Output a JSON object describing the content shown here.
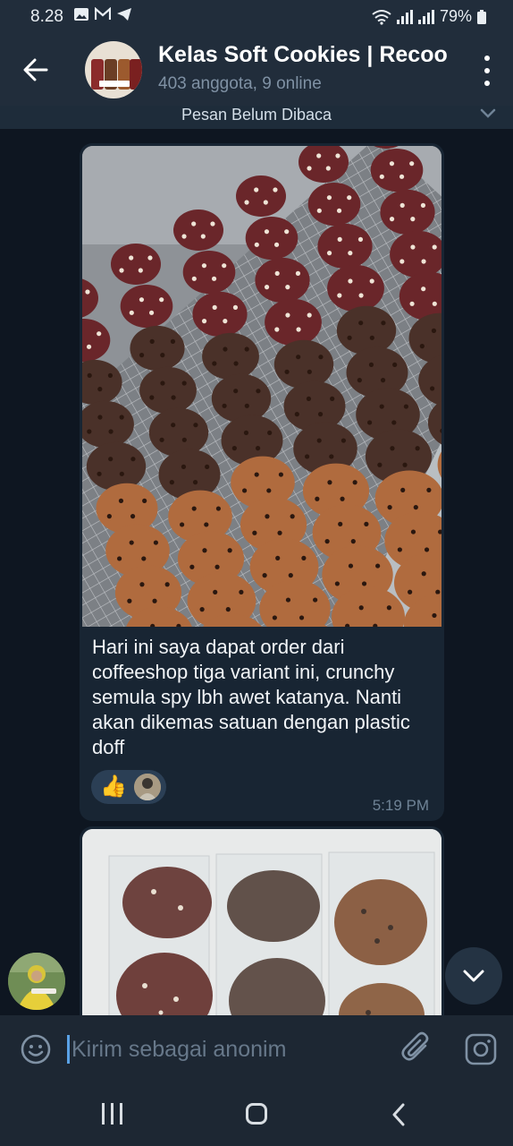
{
  "status_bar": {
    "time": "8.28",
    "battery": "79%"
  },
  "header": {
    "title": "Kelas Soft Cookies | Recoo",
    "subtitle": "403 anggota, 9 online"
  },
  "unread_banner": {
    "label": "Pesan Belum Dibaca"
  },
  "messages": [
    {
      "text": "Hari ini saya dapat order dari coffeeshop tiga variant ini, crunchy semula spy lbh awet katanya. Nanti akan dikemas satuan dengan plastic doff",
      "time": "5:19 PM",
      "reaction": {
        "emoji": "👍"
      }
    }
  ],
  "composer": {
    "placeholder": "Kirim sebagai anonim"
  },
  "colors": {
    "background": "#0e1621",
    "header": "#212d3b",
    "bubble": "#182533",
    "accent": "#5aa2e6"
  },
  "icons": [
    "back-arrow-icon",
    "more-vert-icon",
    "chevron-down-icon",
    "emoji-icon",
    "attach-icon",
    "camera-icon",
    "scroll-down-icon"
  ]
}
